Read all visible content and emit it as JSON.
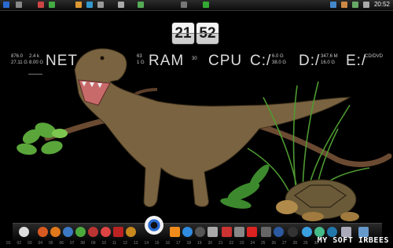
{
  "clock": {
    "hours": "21",
    "minutes": "52"
  },
  "taskbar_top": {
    "time": "20:52"
  },
  "hud": {
    "net": {
      "label": "NET",
      "down": "876.0",
      "down_unit": "2.4 k",
      "up": "27.11 G",
      "up_unit": "8.00 G"
    },
    "ram": {
      "label": "RAM",
      "percent": "63",
      "size": "1 G"
    },
    "cpu": {
      "label": "CPU",
      "percent": "30"
    },
    "c": {
      "label": "C:/",
      "used": "6.0 G",
      "total": "38.0 G"
    },
    "d": {
      "label": "D:/",
      "used": "347.6 M",
      "total": "16.0 G"
    },
    "e": {
      "label": "E:/",
      "info": "CD/DVD"
    }
  },
  "dock_numbers": [
    "01",
    "02",
    "03",
    "04",
    "05",
    "06",
    "07",
    "08",
    "09",
    "10",
    "11",
    "12",
    "13",
    "14",
    "15",
    "16",
    "17",
    "18",
    "19",
    "20",
    "21",
    "22",
    "23",
    "24",
    "25",
    "26",
    "27",
    "28",
    "29",
    "30"
  ],
  "watermark": "MY SOFT IRBEES",
  "colors": {
    "dino": "#7a6340",
    "plant": "#3d8a2e",
    "tortoise": "#6b5a38"
  }
}
